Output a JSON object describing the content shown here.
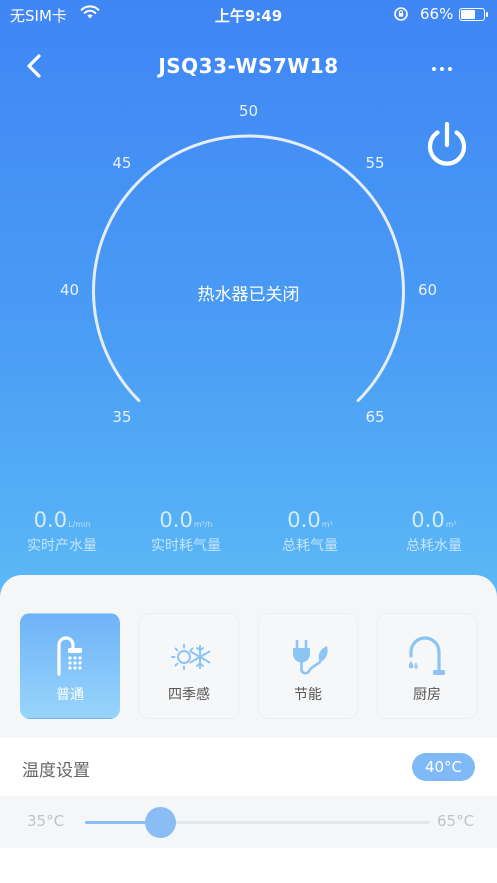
{
  "status_bar": {
    "carrier": "无SIM卡",
    "time": "上午9:49",
    "battery": "66%",
    "battery_level": 0.66
  },
  "nav": {
    "title": "JSQ33-WS7W18"
  },
  "dial": {
    "ticks": [
      "35",
      "40",
      "45",
      "50",
      "55",
      "60",
      "65"
    ],
    "status": "热水器已关闭"
  },
  "stats": [
    {
      "value": "0.0",
      "unit": "L/min",
      "label": "实时产水量"
    },
    {
      "value": "0.0",
      "unit": "m³/h",
      "label": "实时耗气量"
    },
    {
      "value": "0.0",
      "unit": "m³",
      "label": "总耗气量"
    },
    {
      "value": "0.0",
      "unit": "m³",
      "label": "总耗水量"
    }
  ],
  "modes": [
    {
      "label": "普通",
      "icon": "shower-icon",
      "active": true
    },
    {
      "label": "四季感",
      "icon": "sun-snowflake-icon",
      "active": false
    },
    {
      "label": "节能",
      "icon": "plug-leaf-icon",
      "active": false
    },
    {
      "label": "厨房",
      "icon": "faucet-icon",
      "active": false
    }
  ],
  "temperature": {
    "title": "温度设置",
    "current": "40°C",
    "min_label": "35°C",
    "max_label": "65°C",
    "min": 35,
    "max": 65,
    "value": 40
  },
  "colors": {
    "accent": "#7fbaf6",
    "hero_top": "#3f86f5",
    "hero_bottom": "#5cb9f6"
  }
}
